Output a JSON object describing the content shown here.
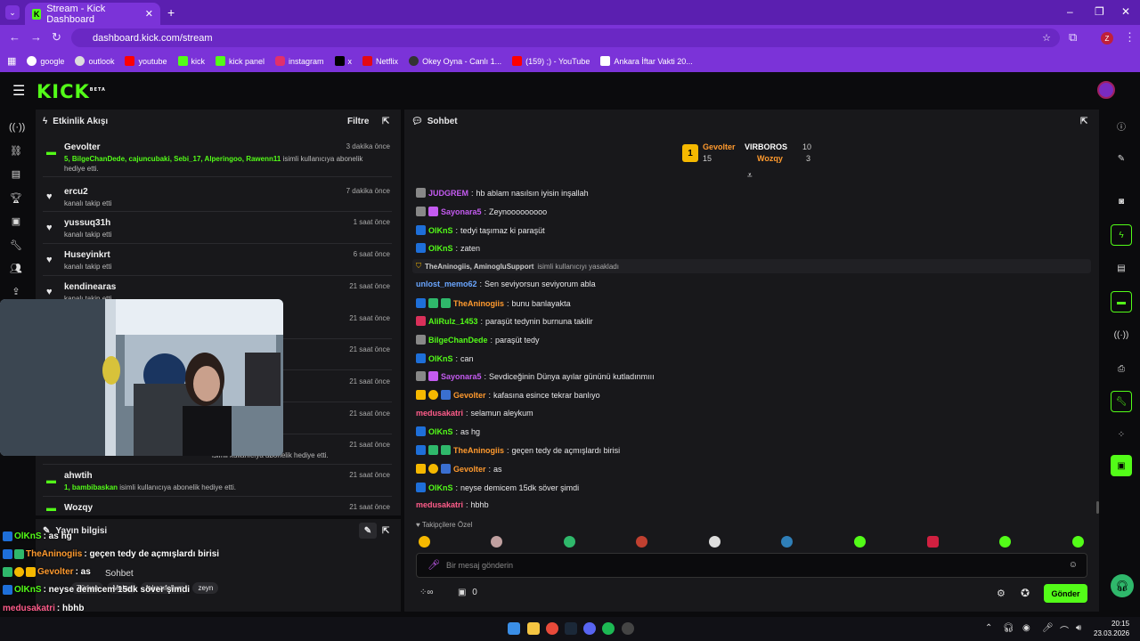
{
  "browser": {
    "tab_title": "Stream - Kick Dashboard",
    "url": "dashboard.kick.com/stream",
    "bookmarks": [
      "google",
      "outlook",
      "youtube",
      "kick",
      "kick panel",
      "instagram",
      "x",
      "Netflix",
      "Okey Oyna - Canlı 1...",
      "(159) ;) - YouTube",
      "Ankara İftar Vakti 20..."
    ],
    "profile_initial": "Z"
  },
  "app": {
    "logo": "KICK",
    "logo_sup": "BETA"
  },
  "activity": {
    "title": "Etkinlik Akışı",
    "filter": "Filtre",
    "items": [
      {
        "name": "Gevolter",
        "sub_names": "5, BilgeChanDede, cajuncubaki, Sebi_17, Alperingoo, Rawenn11",
        "sub_text": "isimli kullanıcıya abonelik",
        "sub_text2": "hediye etti.",
        "time": "3 dakika önce"
      },
      {
        "name": "ercu2",
        "sub": "kanalı takip etti",
        "time": "7 dakika önce"
      },
      {
        "name": "yussuq31h",
        "sub": "kanalı takip etti",
        "time": "1 saat önce"
      },
      {
        "name": "Huseyinkrt",
        "sub": "kanalı takip etti",
        "time": "6 saat önce"
      },
      {
        "name": "kendinearas",
        "sub": "kanalı takip etti",
        "time": "21 saat önce"
      },
      {
        "time": "21 saat önce"
      },
      {
        "time": "21 saat önce"
      },
      {
        "time": "21 saat önce"
      },
      {
        "time": "21 saat önce"
      },
      {
        "time": "21 saat önce",
        "sub": "isimli kullanıcıya abonelik hediye etti."
      },
      {
        "name": "ahwtih",
        "sub_names": "1, bambibaskan",
        "sub_text": "isimli kullanıcıya abonelik hediye etti.",
        "time": "21 saat önce"
      },
      {
        "name": "Wozqy",
        "time": "21 saat önce"
      }
    ]
  },
  "stream_info": {
    "title": "Yayın bilgisi",
    "tags": [
      "Türkçe",
      "Malaş",
      "fakazıfolium",
      "zeyn"
    ],
    "category": "Sohbet"
  },
  "chat": {
    "title": "Sohbet",
    "leaderboard": {
      "first": {
        "name": "Gevolter",
        "count": "15",
        "rank": "1"
      },
      "second": {
        "name": "VIRBOROS",
        "count": "10"
      },
      "third": {
        "name": "Wozqy",
        "count": "3"
      }
    },
    "messages": [
      {
        "user": "JUDGREM",
        "color": "#c45bf0",
        "text": "hb ablam nasılsın iyisin inşallah"
      },
      {
        "user": "Sayonara5",
        "color": "#c45bf0",
        "text": "Zeynooooooooo"
      },
      {
        "user": "OlKnS",
        "color": "#53fc18",
        "text": "tedyi taşımaz ki paraşüt"
      },
      {
        "user": "OlKnS",
        "color": "#53fc18",
        "text": "zaten"
      },
      {
        "user": "unlost_memo62",
        "color": "#6aa6ff",
        "text": "Sen seviyorsun seviyorum abla"
      },
      {
        "user": "TheAninogiis",
        "color": "#ff9a2e",
        "text": "bunu banlayakta"
      },
      {
        "user": "AliRulz_1453",
        "color": "#53fc18",
        "text": "paraşüt tedynin burnuna takilir"
      },
      {
        "user": "BilgeChanDede",
        "color": "#53fc18",
        "text": "paraşüt tedy"
      },
      {
        "user": "OlKnS",
        "color": "#53fc18",
        "text": "can"
      },
      {
        "user": "Sayonara5",
        "color": "#c45bf0",
        "text": "Sevdiceğinin Dünya ayılar gününü kutladınmııı"
      },
      {
        "user": "Gevolter",
        "color": "#ff9a2e",
        "text": "kafasına esince tekrar banlıyo"
      },
      {
        "user": "medusakatri",
        "color": "#ff5c8a",
        "text": "selamun aleykum"
      },
      {
        "user": "OlKnS",
        "color": "#53fc18",
        "text": "as hg"
      },
      {
        "user": "TheAninogiis",
        "color": "#ff9a2e",
        "text": "geçen tedy de açmışlardı birisi"
      },
      {
        "user": "Gevolter",
        "color": "#ff9a2e",
        "text": "as"
      },
      {
        "user": "OlKnS",
        "color": "#53fc18",
        "text": "neyse demicem 15dk söver şimdi"
      },
      {
        "user": "medusakatri",
        "color": "#ff5c8a",
        "text": "hbhb"
      }
    ],
    "ban_notice": {
      "users": "TheAninogiis, AminogluSupport",
      "text": "isimli kullanıcıyı yasakladı"
    },
    "followers_only": "Takipçilere Özel",
    "input_placeholder": "Bir mesaj gönderin",
    "send": "Gönder",
    "points": "0"
  },
  "overlay_chat": [
    {
      "user": "OlKnS",
      "text": ": as hg",
      "color": "#53fc18"
    },
    {
      "user": "TheAninogiis",
      "text": ": geçen tedy de açmışlardı birisi",
      "color": "#ff9a2e"
    },
    {
      "user": "Gevolter",
      "text": ": as",
      "color": "#ff9a2e"
    },
    {
      "user": "OlKnS",
      "text": ": neyse demicem 15dk söver şimdi",
      "color": "#53fc18"
    },
    {
      "user": "medusakatri",
      "text": ": hbhb",
      "color": "#ff5c8a"
    }
  ],
  "taskbar": {
    "time": "20:15",
    "date": "23.03.2026"
  },
  "colors": {
    "accent": "#53fc18",
    "chrome": "#7b33d8"
  }
}
